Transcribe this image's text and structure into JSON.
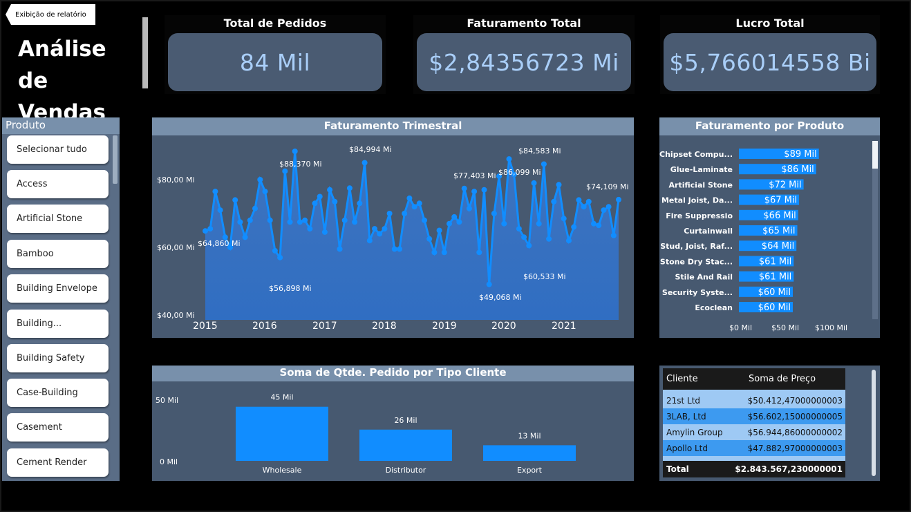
{
  "nav": {
    "back_label": "Exibição de relatório"
  },
  "page_title": "Análise de Vendas",
  "kpis": [
    {
      "label": "Total de Pedidos",
      "value": "84 Mil"
    },
    {
      "label": "Faturamento Total",
      "value": "$2,84356723 Mi"
    },
    {
      "label": "Lucro Total",
      "value": "$5,766014558 Bi"
    }
  ],
  "slicer": {
    "title": "Produto",
    "items": [
      "Selecionar tudo",
      "Access",
      "Artificial Stone",
      "Bamboo",
      "Building Envelope",
      "Building...",
      "Building Safety",
      "Case-Building",
      "Casement",
      "Cement Render"
    ]
  },
  "line_chart": {
    "title": "Faturamento Trimestral",
    "y_ticks": [
      "$80,00 Mi",
      "$60,00 Mi",
      "$40,00 Mi"
    ],
    "x_ticks": [
      "2015",
      "2016",
      "2017",
      "2018",
      "2019",
      "2020",
      "2021"
    ],
    "annotations": [
      "$64,860 Mi",
      "$56,898 Mi",
      "$88,370 Mi",
      "$84,994 Mi",
      "$77,403 Mi",
      "$86,099 Mi",
      "$84,583 Mi",
      "$60,533 Mi",
      "$49,068 Mi",
      "$74,109 Mi"
    ]
  },
  "bar_chart_products": {
    "title": "Faturamento por Produto",
    "x_ticks": [
      "$0 Mil",
      "$50 Mil",
      "$100 Mil"
    ]
  },
  "bar_chart_clients": {
    "title": "Soma de Qtde. Pedido por Tipo Cliente",
    "y_ticks": [
      "50 Mil",
      "0 Mil"
    ]
  },
  "table": {
    "headers": [
      "Cliente",
      "Soma de Preço"
    ],
    "rows": [
      [
        "21st Ltd",
        "$50.412,47000000003"
      ],
      [
        "3LAB, Ltd",
        "$56.602,15000000005"
      ],
      [
        "Amylin Group",
        "$56.944,86000000002"
      ],
      [
        "Apollo Ltd",
        "$47.882,97000000003"
      ]
    ],
    "total_label": "Total",
    "total_value": "$2.843.567,230000001"
  },
  "colors": {
    "accent": "#118dff",
    "panel": "#475970",
    "header": "#7890ab",
    "kpi_text": "#a9cef8"
  },
  "chart_data": [
    {
      "type": "area",
      "title": "Faturamento Trimestral",
      "xlabel": "",
      "ylabel": "",
      "ylim": [
        40,
        90
      ],
      "x_range": [
        2015,
        2022
      ],
      "y_unit": "Mi",
      "values": [
        64.86,
        65.5,
        76.5,
        71,
        63,
        60,
        74,
        67.5,
        63,
        68,
        71.5,
        80,
        76.5,
        68,
        59,
        57,
        82.5,
        67.5,
        88.37,
        67.5,
        68,
        65.5,
        73,
        75,
        64.5,
        77,
        73.5,
        59.5,
        68,
        77.5,
        67.5,
        73,
        84.994,
        62,
        65.5,
        64,
        65.5,
        70,
        59.5,
        59.5,
        70,
        74.5,
        72,
        73,
        68,
        62.5,
        58.5,
        65,
        58.5,
        67,
        69,
        67.5,
        77.403,
        71.5,
        76.5,
        58.5,
        77,
        49.068,
        70,
        81,
        67,
        86.099,
        81.5,
        65.5,
        63,
        60.533,
        79,
        67,
        84.583,
        62.5,
        73.5,
        78.5,
        68.5,
        62,
        66,
        74,
        72,
        73.5,
        67,
        66.5,
        71,
        72,
        63.5,
        74.109
      ]
    },
    {
      "type": "bar",
      "title": "Faturamento por Produto",
      "orientation": "horizontal",
      "categories": [
        "Chipset Compu...",
        "Glue-Laminate",
        "Artificial Stone",
        "Metal Joist, Da...",
        "Fire Suppressio",
        "Curtainwall",
        "Stud, Joist, Raf...",
        "Stone Dry Stac...",
        "Stile And Rail",
        "Security Syste...",
        "Ecoclean"
      ],
      "values": [
        89,
        86,
        72,
        67,
        66,
        65,
        64,
        61,
        61,
        60,
        60
      ],
      "labels": [
        "$89 Mil",
        "$86 Mil",
        "$72 Mil",
        "$67 Mil",
        "$66 Mil",
        "$65 Mil",
        "$64 Mil",
        "$61 Mil",
        "$61 Mil",
        "$60 Mil",
        "$60 Mil"
      ],
      "xlim": [
        0,
        100
      ]
    },
    {
      "type": "bar",
      "title": "Soma de Qtde. Pedido por Tipo Cliente",
      "categories": [
        "Wholesale",
        "Distributor",
        "Export"
      ],
      "values": [
        45,
        26,
        13
      ],
      "labels": [
        "45 Mil",
        "26 Mil",
        "13 Mil"
      ],
      "ylim": [
        0,
        50
      ]
    }
  ]
}
